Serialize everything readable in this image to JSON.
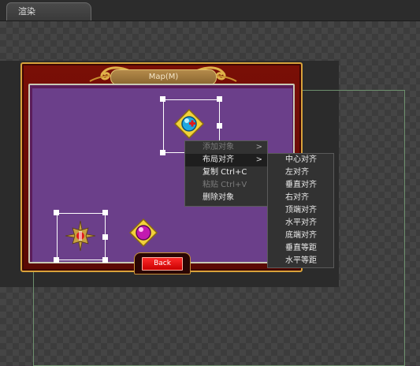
{
  "tab": {
    "label": "渲染"
  },
  "map": {
    "title": "Map(M)",
    "back_label": "Back"
  },
  "context_menu": {
    "items": [
      {
        "label": "添加对象",
        "disabled": true,
        "has_submenu": true
      },
      {
        "label": "布局对齐",
        "disabled": false,
        "has_submenu": true,
        "active": true
      },
      {
        "label": "复制  Ctrl+C",
        "disabled": false
      },
      {
        "label": "粘贴  Ctrl+V",
        "disabled": true
      },
      {
        "label": "删除对象",
        "disabled": false
      }
    ]
  },
  "submenu": {
    "items": [
      "中心对齐",
      "左对齐",
      "垂直对齐",
      "右对齐",
      "顶端对齐",
      "水平对齐",
      "底端对齐",
      "垂直等距",
      "水平等距"
    ]
  }
}
